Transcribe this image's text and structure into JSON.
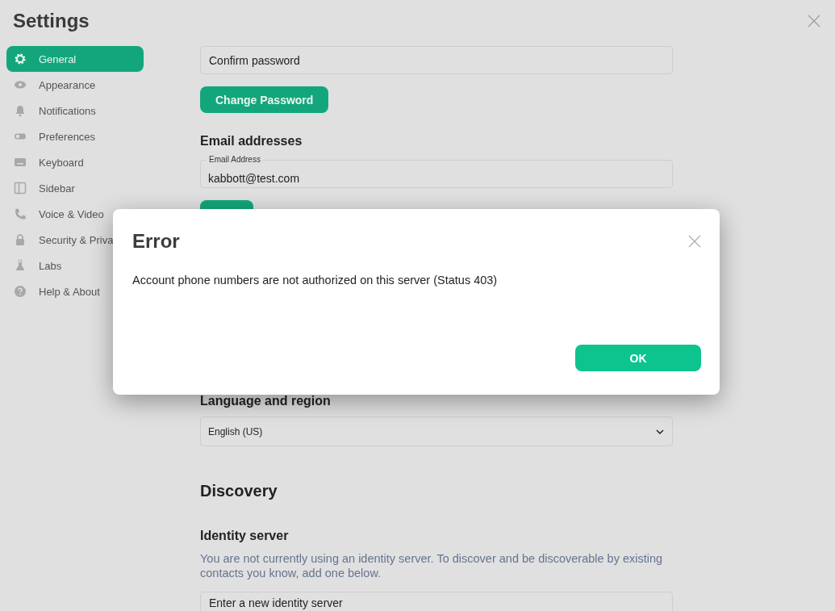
{
  "window": {
    "title": "Settings"
  },
  "sidebar": {
    "items": [
      {
        "label": "General",
        "selected": true
      },
      {
        "label": "Appearance",
        "selected": false
      },
      {
        "label": "Notifications",
        "selected": false
      },
      {
        "label": "Preferences",
        "selected": false
      },
      {
        "label": "Keyboard",
        "selected": false
      },
      {
        "label": "Sidebar",
        "selected": false
      },
      {
        "label": "Voice & Video",
        "selected": false
      },
      {
        "label": "Security & Priva",
        "selected": false
      },
      {
        "label": "Labs",
        "selected": false
      },
      {
        "label": "Help & About",
        "selected": false
      }
    ]
  },
  "password": {
    "confirm_field": {
      "placeholder": "Confirm password"
    },
    "button": "Change Password"
  },
  "email": {
    "heading": "Email addresses",
    "field": {
      "label": "Email Address",
      "value": "kabbott@test.com"
    }
  },
  "language": {
    "heading": "Language and region",
    "select": {
      "value": "English (US)"
    }
  },
  "discovery": {
    "heading": "Discovery",
    "identity_server": {
      "heading": "Identity server",
      "description": "You are not currently using an identity server. To discover and be discoverable by existing contacts you know, add one below.",
      "field": {
        "placeholder": "Enter a new identity server"
      }
    }
  },
  "dialog": {
    "title": "Error",
    "message": "Account phone numbers are not authorized on this server (Status 403)",
    "button": "OK"
  }
}
